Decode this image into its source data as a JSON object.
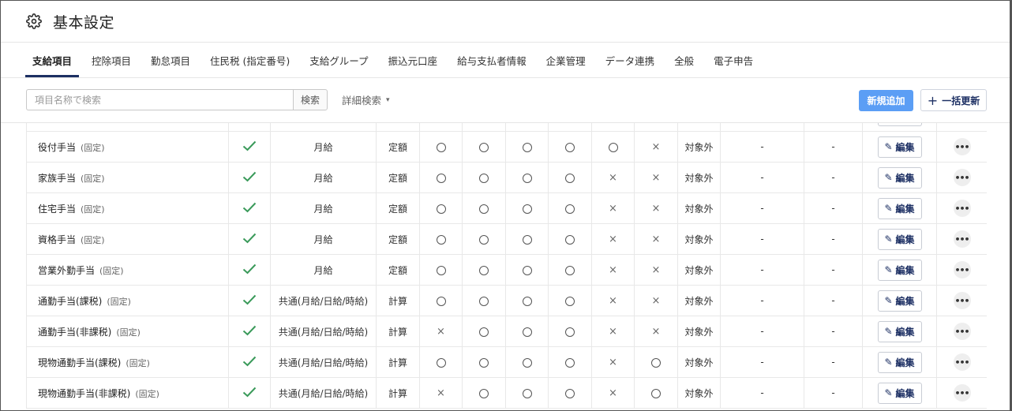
{
  "header": {
    "title": "基本設定",
    "icon": "gear-icon"
  },
  "tabs": [
    {
      "label": "支給項目",
      "active": true
    },
    {
      "label": "控除項目",
      "active": false
    },
    {
      "label": "勤怠項目",
      "active": false
    },
    {
      "label": "住民税 (指定番号)",
      "active": false
    },
    {
      "label": "支給グループ",
      "active": false
    },
    {
      "label": "振込元口座",
      "active": false
    },
    {
      "label": "給与支払者情報",
      "active": false
    },
    {
      "label": "企業管理",
      "active": false
    },
    {
      "label": "データ連携",
      "active": false
    },
    {
      "label": "全般",
      "active": false
    },
    {
      "label": "電子申告",
      "active": false
    }
  ],
  "toolbar": {
    "search_placeholder": "項目名称で検索",
    "search_button": "検索",
    "advanced_search": "詳細検索",
    "new_button": "新規追加",
    "bulk_update_button": "一括更新",
    "accent_color": "#5b9ef5"
  },
  "table": {
    "fixed_label": "(固定)",
    "edit_label": "編集",
    "rows": [
      {
        "name": "役付手当",
        "type": "月給",
        "calc": "定額",
        "c1": "○",
        "c2": "○",
        "c3": "○",
        "c4": "○",
        "c5": "○",
        "c6": "×",
        "status": "対象外",
        "d1": "-",
        "d2": "-"
      },
      {
        "name": "家族手当",
        "type": "月給",
        "calc": "定額",
        "c1": "○",
        "c2": "○",
        "c3": "○",
        "c4": "○",
        "c5": "×",
        "c6": "×",
        "status": "対象外",
        "d1": "-",
        "d2": "-"
      },
      {
        "name": "住宅手当",
        "type": "月給",
        "calc": "定額",
        "c1": "○",
        "c2": "○",
        "c3": "○",
        "c4": "○",
        "c5": "×",
        "c6": "×",
        "status": "対象外",
        "d1": "-",
        "d2": "-"
      },
      {
        "name": "資格手当",
        "type": "月給",
        "calc": "定額",
        "c1": "○",
        "c2": "○",
        "c3": "○",
        "c4": "○",
        "c5": "×",
        "c6": "×",
        "status": "対象外",
        "d1": "-",
        "d2": "-"
      },
      {
        "name": "営業外勤手当",
        "type": "月給",
        "calc": "定額",
        "c1": "○",
        "c2": "○",
        "c3": "○",
        "c4": "○",
        "c5": "×",
        "c6": "×",
        "status": "対象外",
        "d1": "-",
        "d2": "-"
      },
      {
        "name": "通勤手当(課税)",
        "type": "共通(月給/日給/時給)",
        "calc": "計算",
        "c1": "○",
        "c2": "○",
        "c3": "○",
        "c4": "○",
        "c5": "×",
        "c6": "×",
        "status": "対象外",
        "d1": "-",
        "d2": "-"
      },
      {
        "name": "通勤手当(非課税)",
        "type": "共通(月給/日給/時給)",
        "calc": "計算",
        "c1": "×",
        "c2": "○",
        "c3": "○",
        "c4": "○",
        "c5": "×",
        "c6": "×",
        "status": "対象外",
        "d1": "-",
        "d2": "-"
      },
      {
        "name": "現物通勤手当(課税)",
        "type": "共通(月給/日給/時給)",
        "calc": "計算",
        "c1": "○",
        "c2": "○",
        "c3": "○",
        "c4": "○",
        "c5": "×",
        "c6": "○",
        "status": "対象外",
        "d1": "-",
        "d2": "-"
      },
      {
        "name": "現物通勤手当(非課税)",
        "type": "共通(月給/日給/時給)",
        "calc": "計算",
        "c1": "×",
        "c2": "○",
        "c3": "○",
        "c4": "○",
        "c5": "×",
        "c6": "○",
        "status": "対象外",
        "d1": "-",
        "d2": "-"
      }
    ]
  }
}
